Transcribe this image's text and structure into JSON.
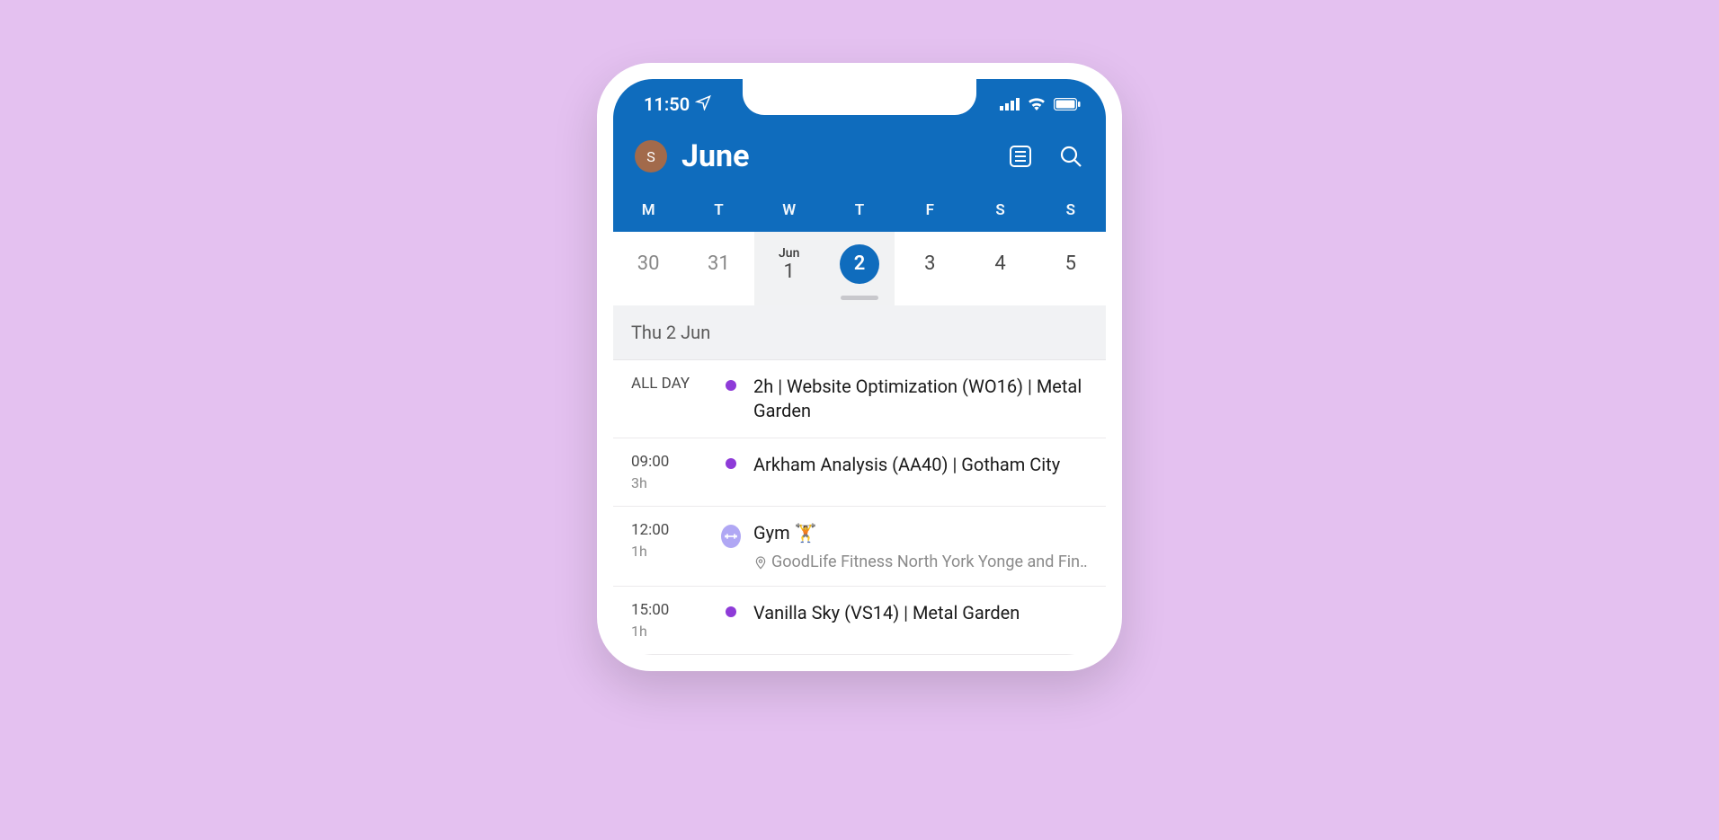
{
  "status": {
    "time": "11:50",
    "avatar_initial": "S"
  },
  "header": {
    "month": "June"
  },
  "weekdays": [
    "M",
    "T",
    "W",
    "T",
    "F",
    "S",
    "S"
  ],
  "dates": [
    {
      "num": "30",
      "muted": true
    },
    {
      "num": "31",
      "muted": true
    },
    {
      "month": "Jun",
      "num": "1",
      "highlight": true
    },
    {
      "num": "2",
      "selected": true,
      "highlight": true
    },
    {
      "num": "3"
    },
    {
      "num": "4"
    },
    {
      "num": "5"
    }
  ],
  "agenda": {
    "section_label": "Thu 2 Jun",
    "events": [
      {
        "time": "ALL DAY",
        "duration": "",
        "indicator": "dot",
        "color": "#8e3bd8",
        "title": "2h | Website Optimization (WO16) | Metal Garden"
      },
      {
        "time": "09:00",
        "duration": "3h",
        "indicator": "dot",
        "color": "#8e3bd8",
        "title": "Arkham Analysis (AA40) | Gotham City"
      },
      {
        "time": "12:00",
        "duration": "1h",
        "indicator": "icon",
        "color": "#b0a7f4",
        "title": "Gym 🏋️",
        "location": "GoodLife Fitness North York Yonge and Fin…"
      },
      {
        "time": "15:00",
        "duration": "1h",
        "indicator": "dot",
        "color": "#8e3bd8",
        "title": "Vanilla Sky (VS14) | Metal Garden"
      }
    ]
  }
}
